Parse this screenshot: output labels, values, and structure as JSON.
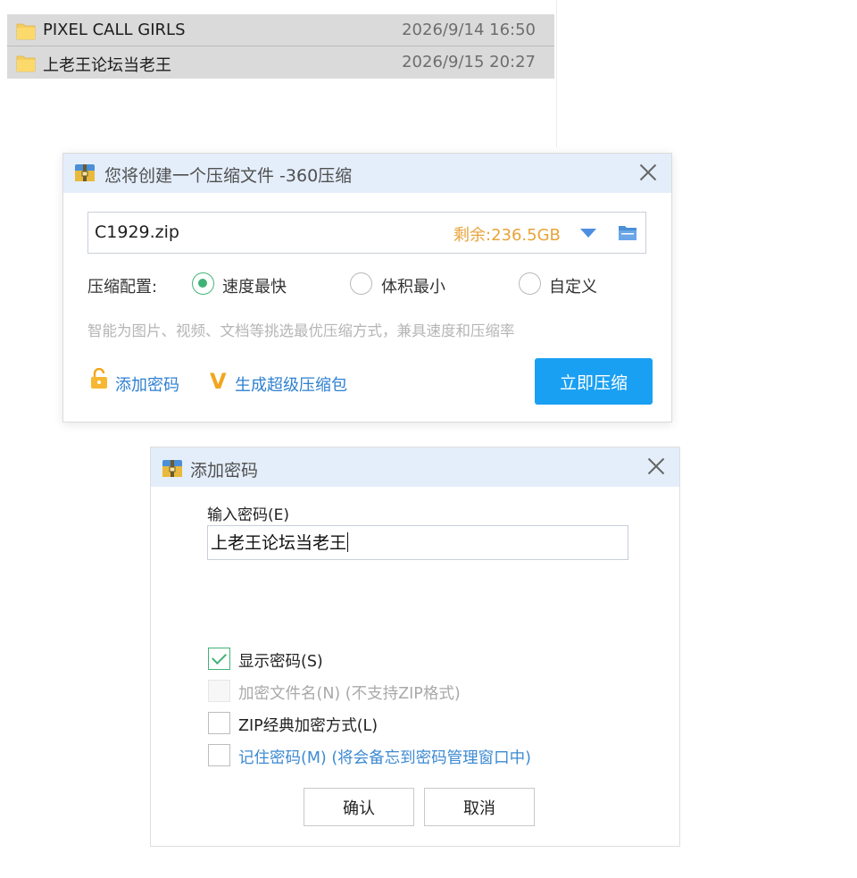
{
  "files": [
    {
      "name": "PIXEL CALL GIRLS",
      "date": "2026/9/14 16:50"
    },
    {
      "name": "上老王论坛当老王",
      "date": "2026/9/15 20:27"
    }
  ],
  "compress_dialog": {
    "title": "您将创建一个压缩文件 -360压缩",
    "path": "C1929.zip",
    "free_space": "剩余:236.5GB",
    "config_label": "压缩配置:",
    "options": [
      {
        "label": "速度最快",
        "selected": true
      },
      {
        "label": "体积最小",
        "selected": false
      },
      {
        "label": "自定义",
        "selected": false
      }
    ],
    "hint": "智能为图片、视频、文档等挑选最优压缩方式，兼具速度和压缩率",
    "add_password_link": "添加密码",
    "super_pack_link": "生成超级压缩包",
    "super_pack_icon": "V",
    "compress_button": "立即压缩"
  },
  "password_dialog": {
    "title": "添加密码",
    "input_label": "输入密码(E)",
    "password_value": "上老王论坛当老王",
    "checkboxes": [
      {
        "label": "显示密码(S)",
        "checked": true,
        "disabled": false
      },
      {
        "label": "加密文件名(N) (不支持ZIP格式)",
        "checked": false,
        "disabled": true
      },
      {
        "label": "ZIP经典加密方式(L)",
        "checked": false,
        "disabled": false
      },
      {
        "label": "记住密码(M) (将会备忘到密码管理窗口中)",
        "checked": false,
        "disabled": false
      }
    ],
    "ok_button": "确认",
    "cancel_button": "取消"
  },
  "colors": {
    "accent_blue": "#1aa0f2",
    "link_blue": "#2f80d1",
    "check_green": "#3fb376",
    "free_space_orange": "#e8a33a",
    "titlebar_bg": "#e4eefa",
    "folder_yellow": "#f5cd5f"
  }
}
